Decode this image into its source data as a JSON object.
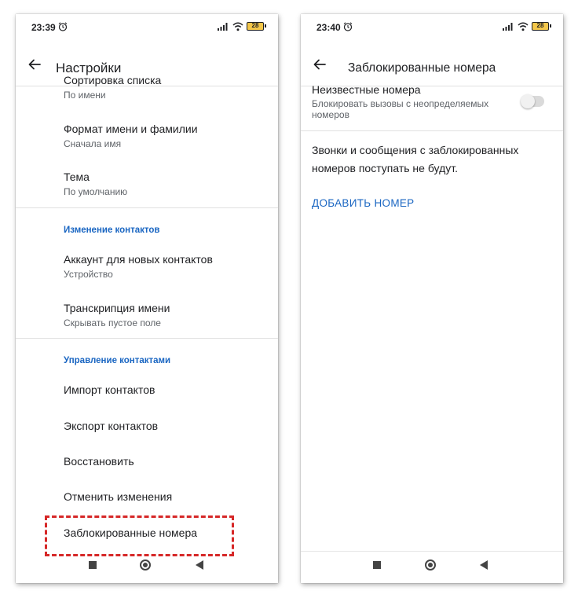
{
  "left_screen": {
    "status": {
      "time": "23:39",
      "battery": "28"
    },
    "title": "Настройки",
    "items_top": [
      {
        "title": "Сортировка списка",
        "subtitle": "По имени"
      },
      {
        "title": "Формат имени и фамилии",
        "subtitle": "Сначала имя"
      },
      {
        "title": "Тема",
        "subtitle": "По умолчанию"
      }
    ],
    "section_edit": "Изменение контактов",
    "items_edit": [
      {
        "title": "Аккаунт для новых контактов",
        "subtitle": "Устройство"
      },
      {
        "title": "Транскрипция имени",
        "subtitle": "Скрывать пустое поле"
      }
    ],
    "section_manage": "Управление контактами",
    "items_manage": [
      {
        "title": "Импорт контактов"
      },
      {
        "title": "Экспорт контактов"
      },
      {
        "title": "Восстановить"
      },
      {
        "title": "Отменить изменения"
      },
      {
        "title": "Заблокированные номера"
      }
    ]
  },
  "right_screen": {
    "status": {
      "time": "23:40",
      "battery": "28"
    },
    "title": "Заблокированные номера",
    "unknown_numbers": {
      "title": "Неизвестные номера",
      "subtitle": "Блокировать вызовы с неопределяемых номеров",
      "enabled": false
    },
    "info": "Звонки и сообщения с заблокированных номеров поступать не будут.",
    "add_button": "ДОБАВИТЬ НОМЕР"
  },
  "colors": {
    "accent": "#1a66c2",
    "highlight": "#d62828",
    "text_primary": "#202124",
    "text_secondary": "#5f6368"
  },
  "icons": {
    "alarm": "alarm-icon",
    "signal": "signal-icon",
    "wifi": "wifi-icon",
    "back": "arrow-left-icon",
    "nav_recents": "square-icon",
    "nav_home": "circle-icon",
    "nav_back": "triangle-left-icon"
  }
}
